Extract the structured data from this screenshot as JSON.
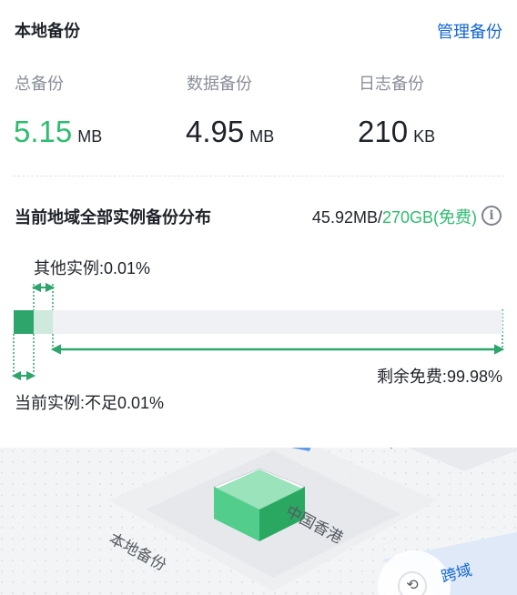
{
  "header": {
    "title": "本地备份",
    "manage_link": "管理备份"
  },
  "stats": [
    {
      "label": "总备份",
      "value": "5.15",
      "unit": "MB",
      "highlight": true
    },
    {
      "label": "数据备份",
      "value": "4.95",
      "unit": "MB",
      "highlight": false
    },
    {
      "label": "日志备份",
      "value": "210",
      "unit": "KB",
      "highlight": false
    }
  ],
  "distribution": {
    "title": "当前地域全部实例备份分布",
    "used": "45.92MB/",
    "free": "270GB(免费)",
    "others_label": "其他实例:0.01%",
    "remaining_label": "剩余免费:99.98%",
    "current_label": "当前实例:不足0.01%",
    "shares": {
      "current_percent": 0.01,
      "others_percent": 0.01,
      "remaining_percent": 99.98
    }
  },
  "map": {
    "local_label": "本地备份",
    "region_label": "中国香港",
    "cross_region_label": "跨域",
    "partial_label": "备",
    "node_icon": "history-icon"
  },
  "colors": {
    "accent_green": "#2dbd6e",
    "link_blue": "#1166d6",
    "bar_track": "#eff1f4"
  }
}
